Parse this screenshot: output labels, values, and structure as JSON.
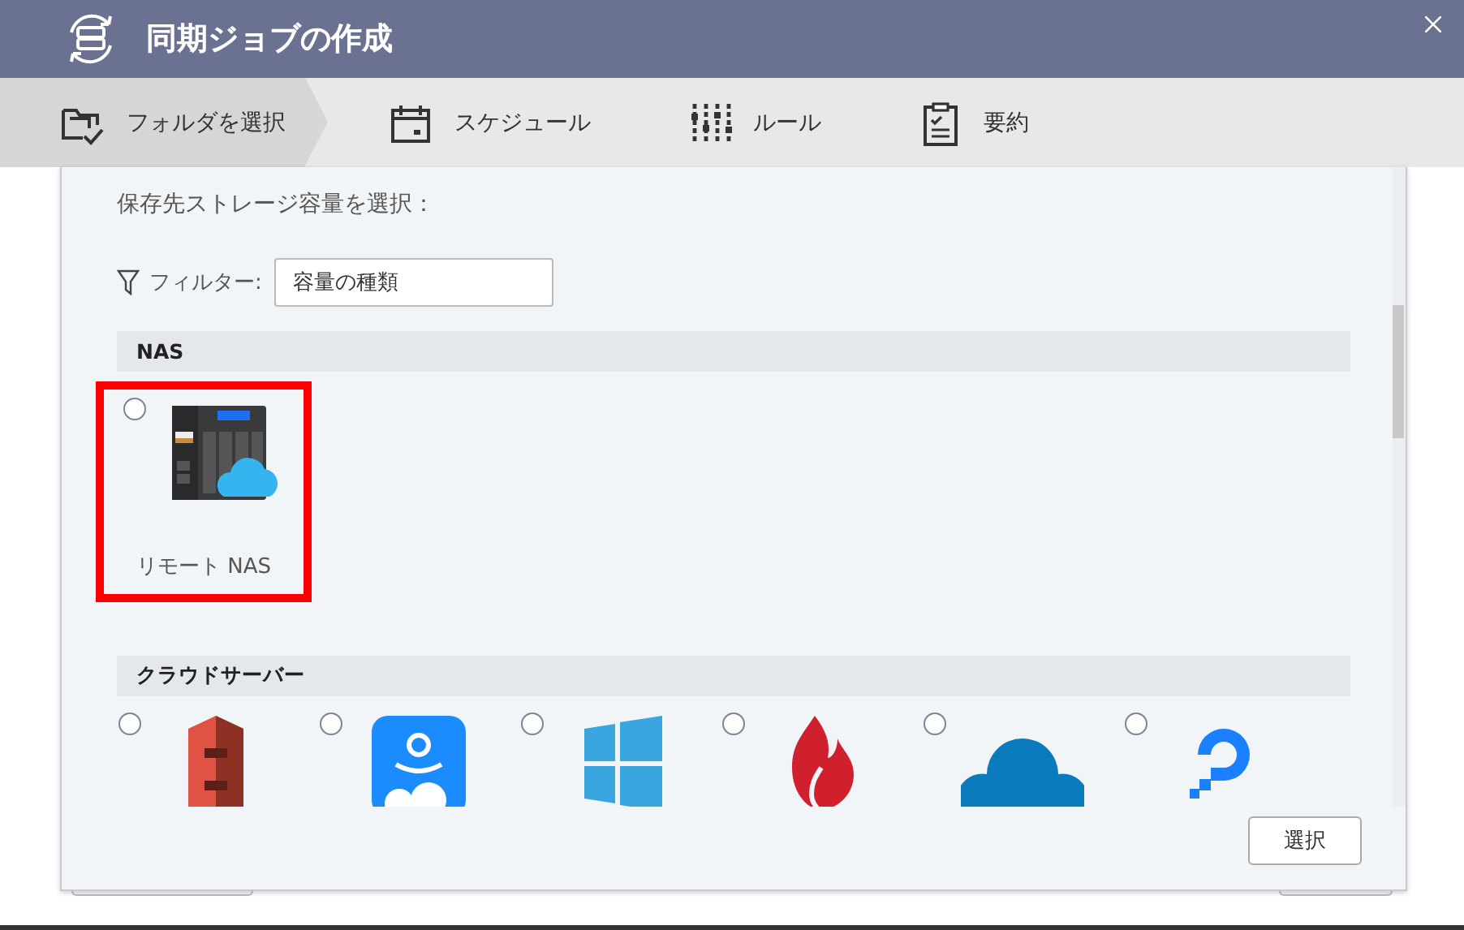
{
  "window": {
    "title": "同期ジョブの作成"
  },
  "steps": [
    {
      "label": "フォルダを選択",
      "selected": true,
      "kind": "folder"
    },
    {
      "label": "スケジュール",
      "selected": false,
      "kind": "calendar"
    },
    {
      "label": "ルール",
      "selected": false,
      "kind": "sliders"
    },
    {
      "label": "要約",
      "selected": false,
      "kind": "clipboard"
    }
  ],
  "prompt": "保存先ストレージ容量を選択：",
  "filter": {
    "label": "フィルター:",
    "value": "容量の種類"
  },
  "groups": [
    {
      "title": "NAS",
      "items": [
        {
          "label": "リモート NAS",
          "kind": "nas",
          "checked": false,
          "highlighted": true
        }
      ]
    },
    {
      "title": "クラウドサーバー",
      "items": [
        {
          "kind": "stack",
          "checked": false
        },
        {
          "kind": "tile",
          "checked": false
        },
        {
          "kind": "panes",
          "checked": false
        },
        {
          "kind": "flame",
          "checked": false
        },
        {
          "kind": "cloud",
          "checked": false
        },
        {
          "kind": "ring",
          "checked": false
        }
      ]
    }
  ],
  "buttons": [
    "選択"
  ]
}
